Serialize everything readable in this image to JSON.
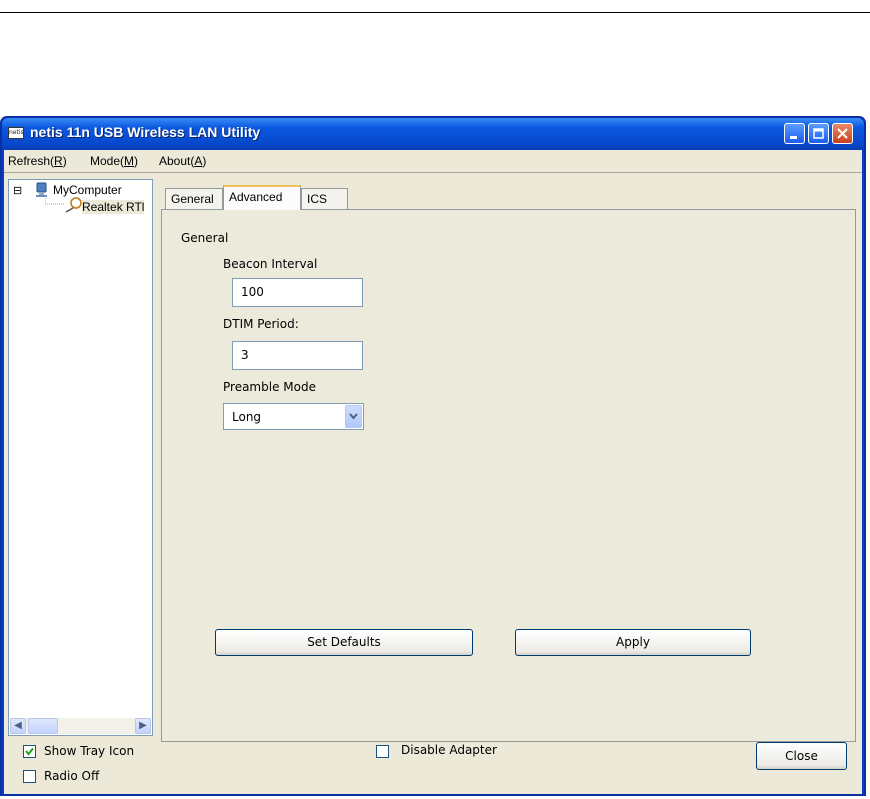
{
  "window": {
    "title": "netis 11n USB Wireless LAN Utility",
    "icon_text": "netis"
  },
  "menu": {
    "refresh": "Refresh(",
    "refresh_key": "R",
    "mode": "Mode(",
    "mode_key": "M",
    "about": "About(",
    "about_key": "A",
    "close_paren": ")"
  },
  "tree": {
    "root": "MyComputer",
    "child": "Realtek RTl",
    "expander": "⊟"
  },
  "tabs": [
    "General",
    "Advanced",
    "ICS"
  ],
  "advanced": {
    "group_label": "General",
    "beacon_label": "Beacon Interval",
    "beacon_value": "100",
    "dtim_label": "DTIM Period:",
    "dtim_value": "3",
    "preamble_label": "Preamble Mode",
    "preamble_value": "Long",
    "set_defaults": "Set Defaults",
    "apply": "Apply"
  },
  "footer": {
    "show_tray_icon": "Show Tray Icon",
    "show_tray_icon_checked": true,
    "radio_off": "Radio Off",
    "radio_off_checked": false,
    "disable_adapter": "Disable Adapter",
    "disable_adapter_checked": false,
    "close": "Close"
  },
  "colors": {
    "titlebar": "#0b58e0",
    "window_bg": "#ece9d8",
    "close_button": "#c9401c"
  }
}
